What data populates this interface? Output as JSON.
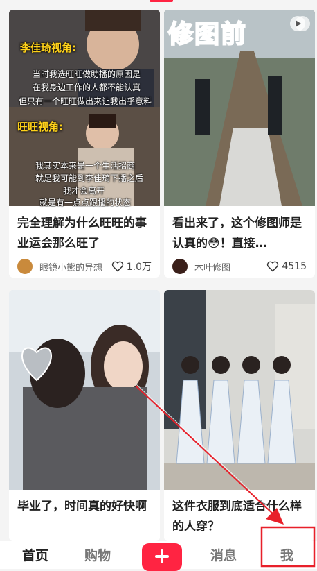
{
  "feed": {
    "cards": [
      {
        "title": "完全理解为什么旺旺的事业运会那么旺了",
        "author": "眼镜小熊的异想",
        "likes": "1.0万",
        "overlay": {
          "tag1": "李佳琦视角:",
          "line1": "当时我选旺旺做助播的原因是",
          "line2": "在我身边工作的人都不能认真",
          "line3": "但只有一个旺旺做出来让我出乎意料",
          "tag2": "旺旺视角:",
          "line4": "我其实本来是一个生活招商",
          "line5": "就是我可能到李佳琦下播之后",
          "line6": "我才会离开",
          "line7": "就是有一点点跟播的状态"
        }
      },
      {
        "title": "看出来了，这个修图师是认真的😳！直接…",
        "author": "木叶修图",
        "likes": "4515",
        "overlay": {
          "big_text": "修图前"
        }
      },
      {
        "title": "毕业了，时间真的好快啊",
        "author": "",
        "likes": ""
      },
      {
        "title": "这件衣服到底适合什么样的人穿？",
        "author": "",
        "likes": ""
      }
    ]
  },
  "tabbar": {
    "home": "首页",
    "shop": "购物",
    "messages": "消息",
    "me": "我"
  },
  "colors": {
    "accent": "#ff2442",
    "annotation": "#e8202a"
  }
}
